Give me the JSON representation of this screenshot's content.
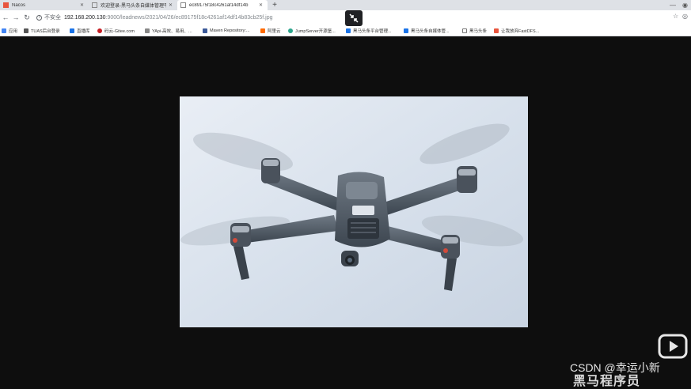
{
  "tabs": [
    {
      "title": "Nacos",
      "color": "#e8553e",
      "active": false
    },
    {
      "title": "欢迎登录-黑马头条自媒体管理平台",
      "color": "#888888",
      "active": false
    },
    {
      "title": "ec89175f18c4261af14df14b",
      "color": "#888888",
      "active": true
    }
  ],
  "address": {
    "security": "不安全",
    "host": "192.168.200.130",
    "path": ":9000/leadnews/2021/04/26/ec89175f18c4261af14df14b83cb25f.jpg"
  },
  "bookmarks": [
    {
      "label": "应用",
      "color": "#4285f4"
    },
    {
      "label": "TUAS后台登录",
      "color": "#555555"
    },
    {
      "label": "直播库",
      "color": "#1a73e8"
    },
    {
      "label": "码云-Gitee.com",
      "color": "#c71d23"
    },
    {
      "label": "YApi-高效、易用、...",
      "color": "#888888"
    },
    {
      "label": "Maven Repository:...",
      "color": "#3b5998"
    },
    {
      "label": "阿里云",
      "color": "#ff6a00"
    },
    {
      "label": "JumpServer开源堡...",
      "color": "#2ca58d"
    },
    {
      "label": "黑马头条平台管理...",
      "color": "#1a73e8"
    },
    {
      "label": "黑马头条自媒体管...",
      "color": "#1a73e8"
    },
    {
      "label": "黑马头条",
      "color": "#777777"
    },
    {
      "label": "让我放弃FastDFS...",
      "color": "#e8553e"
    }
  ],
  "watermark": {
    "csdn": "CSDN @幸运小新",
    "brand": "黑马程序员"
  }
}
